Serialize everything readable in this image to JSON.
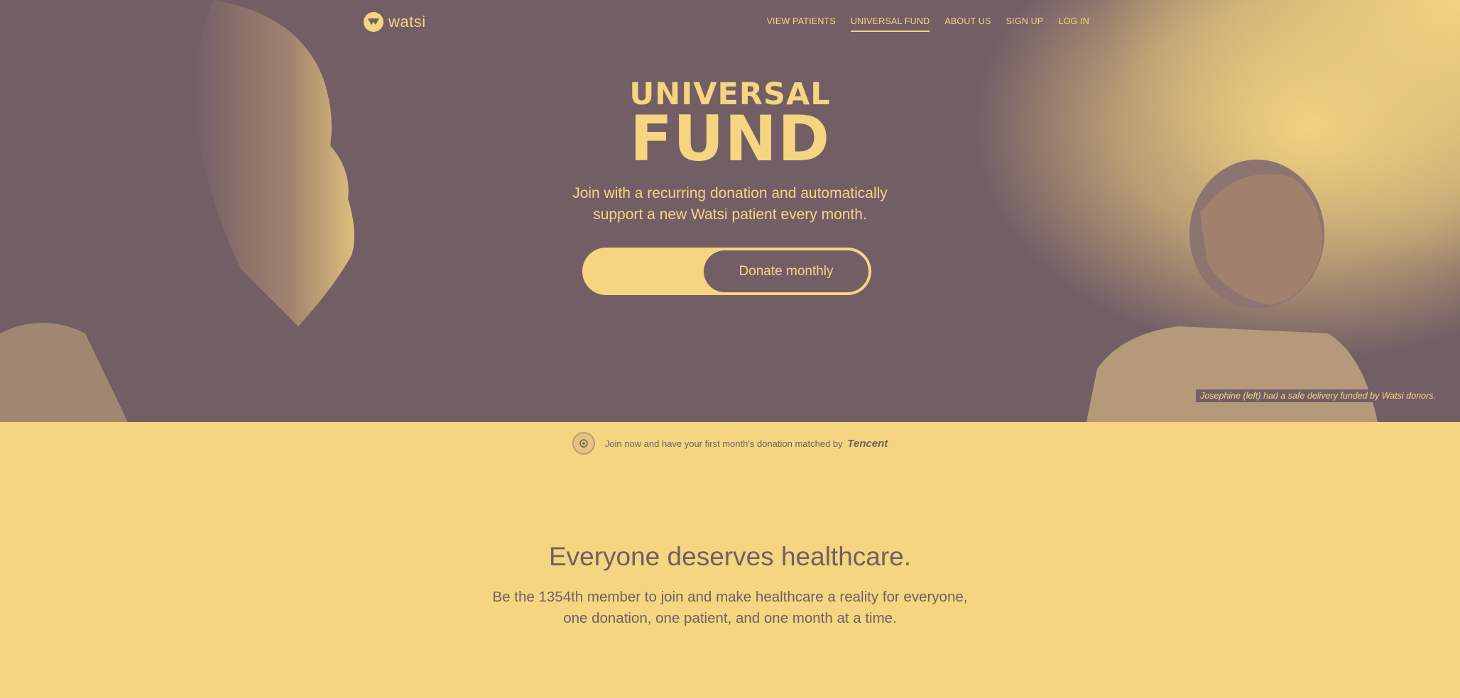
{
  "brand": {
    "logo_text": "watsi"
  },
  "nav": {
    "items": [
      {
        "label": "VIEW PATIENTS",
        "active": false
      },
      {
        "label": "UNIVERSAL FUND",
        "active": true
      },
      {
        "label": "ABOUT US",
        "active": false
      },
      {
        "label": "SIGN UP",
        "active": false
      },
      {
        "label": "LOG IN",
        "active": false
      }
    ]
  },
  "hero": {
    "title_line1": "UNIVERSAL",
    "title_line2": "FUND",
    "subtitle_line1": "Join with a recurring donation and automatically",
    "subtitle_line2": "support a new Watsi patient every month.",
    "donate_label": "Donate monthly",
    "amount_value": "",
    "caption": "Josephine (left) had a safe delivery funded by Watsi donors."
  },
  "match": {
    "text": "Join now and have your first month's donation matched by",
    "brand": "Tencent"
  },
  "mission": {
    "title": "Everyone deserves healthcare.",
    "line1": "Be the 1354th member to join and make healthcare a reality for everyone,",
    "line2": "one donation, one patient, and one month at a time."
  },
  "colors": {
    "plum": "#735e66",
    "gold": "#f5d580"
  },
  "icons": [
    "watsi-logo-icon",
    "tencent-badge-icon"
  ]
}
